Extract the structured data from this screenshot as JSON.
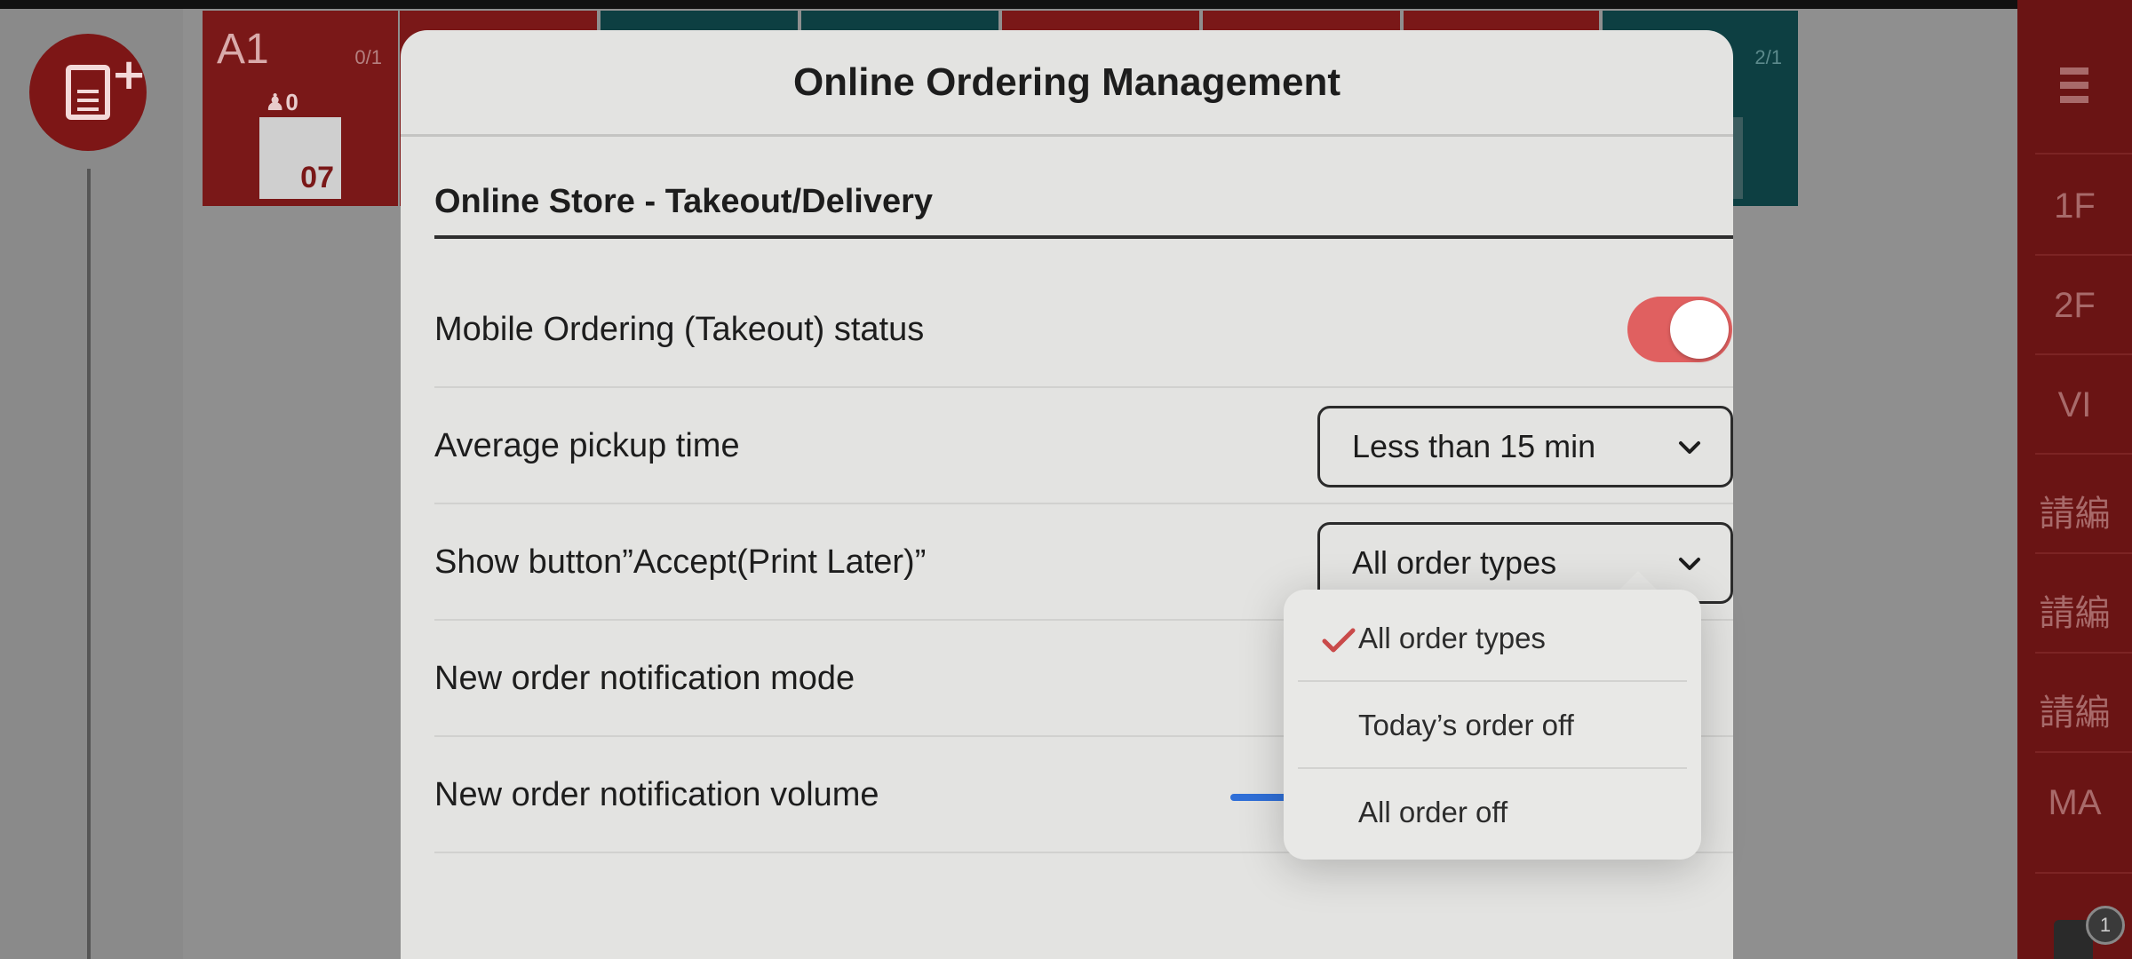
{
  "background": {
    "tables": [
      {
        "name": "A1",
        "count": "0/1",
        "guests": "0",
        "card_number": "07"
      },
      {
        "name": "",
        "count": "2/1",
        "guests": "",
        "card_number": ""
      }
    ],
    "floors": [
      "1F",
      "2F",
      "VI",
      "請編",
      "請編",
      "請編",
      "MA"
    ],
    "badge_count": "1"
  },
  "modal": {
    "title": "Online Ordering Management",
    "section_title": "Online Store - Takeout/Delivery",
    "rows": {
      "mobile_ordering": {
        "label": "Mobile Ordering (Takeout) status",
        "enabled": true
      },
      "pickup_time": {
        "label": "Average pickup time",
        "value": "Less than 15 min"
      },
      "accept_print_later": {
        "label": "Show button”Accept(Print Later)”",
        "value": "All order types"
      },
      "notification_mode": {
        "label": "New order notification mode"
      },
      "notification_volume": {
        "label": "New order notification volume"
      }
    }
  },
  "popover": {
    "options": [
      {
        "label": "All order types",
        "selected": true
      },
      {
        "label": "Today’s order off",
        "selected": false
      },
      {
        "label": "All order off",
        "selected": false
      }
    ]
  },
  "colors": {
    "accent_red": "#e06060",
    "check_red": "#c94a4a",
    "slider_blue": "#2f6fd8"
  }
}
